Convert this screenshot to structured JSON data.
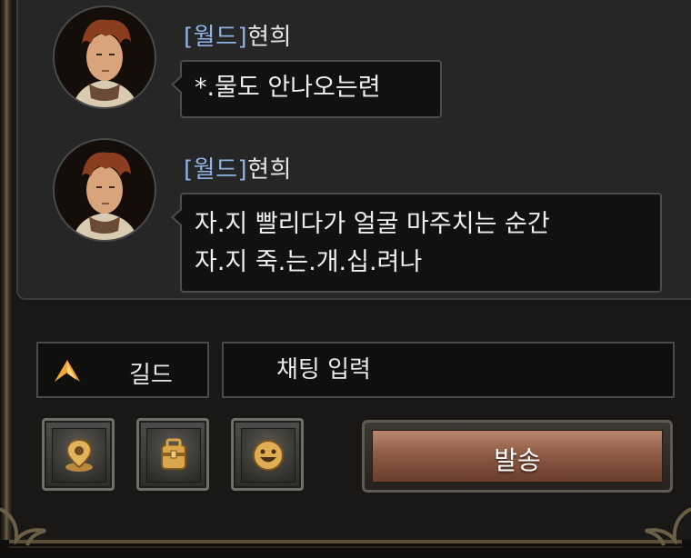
{
  "messages": [
    {
      "channel": "[월드]",
      "name": "현희",
      "lines": [
        "*.물도 안나오는련"
      ]
    },
    {
      "channel": "[월드]",
      "name": "현희",
      "lines": [
        "자.지 빨리다가 얼굴 마주치는 순간",
        "자.지 죽.는.개.십.려나"
      ]
    }
  ],
  "input_bar": {
    "channel_label": "길드",
    "chat_placeholder": "채팅 입력",
    "chevron_icon": "chevron-up-icon"
  },
  "toolbar": {
    "buttons": [
      {
        "icon": "location-pin-icon"
      },
      {
        "icon": "backpack-icon"
      },
      {
        "icon": "smiley-face-icon"
      }
    ],
    "send_label": "발송"
  },
  "colors": {
    "channel_tag": "#8db3e6",
    "send_button": "#9a6650",
    "chevron": "#f3a43a"
  }
}
